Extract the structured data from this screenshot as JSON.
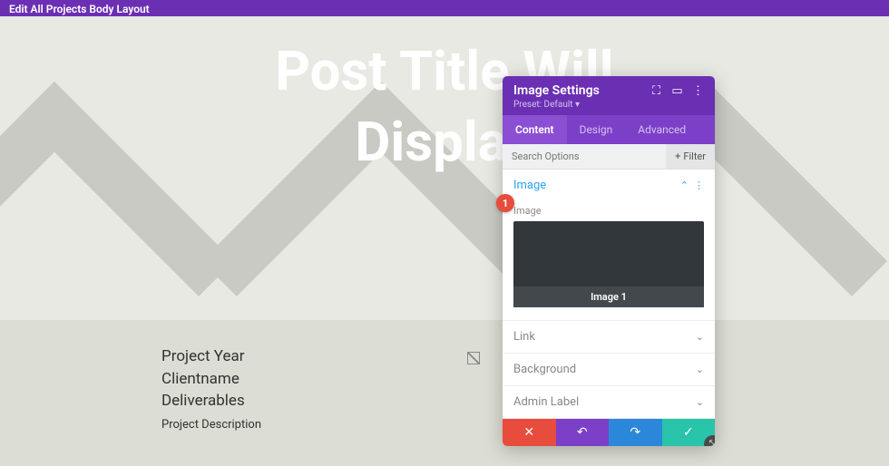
{
  "topbar": {
    "title": "Edit All Projects Body Layout"
  },
  "hero": {
    "title_line1": "Post Title Will",
    "title_line2": "Display "
  },
  "content": {
    "meta": [
      "Project Year",
      "Clientname",
      "Deliverables"
    ],
    "description": "Project Description"
  },
  "callout": {
    "num": "1"
  },
  "panel": {
    "title": "Image Settings",
    "preset": "Preset: Default ",
    "tabs": [
      "Content",
      "Design",
      "Advanced"
    ],
    "active_tab": 0,
    "search": {
      "placeholder": "Search Options"
    },
    "filter": {
      "label": "Filter"
    },
    "sections": {
      "image": {
        "label": "Image",
        "field_label": "Image",
        "caption": "Image 1"
      },
      "link": {
        "label": "Link"
      },
      "background": {
        "label": "Background"
      },
      "admin": {
        "label": "Admin Label"
      }
    }
  }
}
